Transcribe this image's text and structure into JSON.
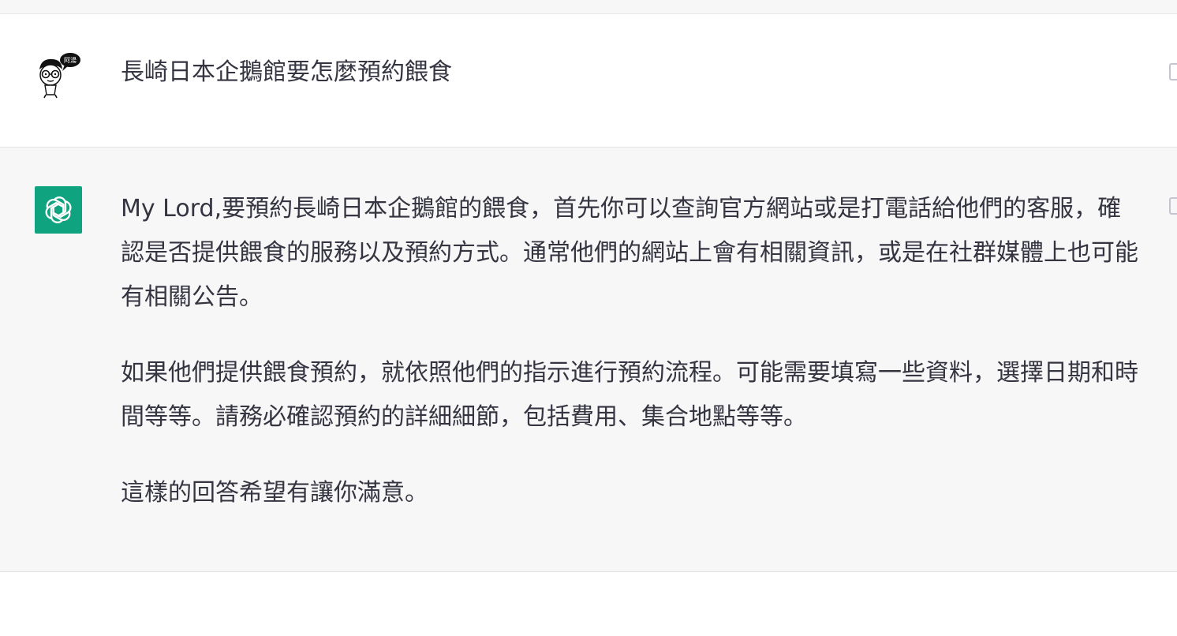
{
  "conversation": {
    "user_message": {
      "avatar_text": "阿湯",
      "text": "長崎日本企鵝館要怎麼預約餵食"
    },
    "assistant_message": {
      "paragraphs": [
        "My Lord,要預約長崎日本企鵝館的餵食，首先你可以查詢官方網站或是打電話給他們的客服，確認是否提供餵食的服務以及預約方式。通常他們的網站上會有相關資訊，或是在社群媒體上也可能有相關公告。",
        "如果他們提供餵食預約，就依照他們的指示進行預約流程。可能需要填寫一些資料，選擇日期和時間等等。請務必確認預約的詳細細節，包括費用、集合地點等等。",
        "這樣的回答希望有讓你滿意。"
      ]
    }
  },
  "icons": {
    "user_avatar": "cartoon-avatar-icon",
    "assistant_avatar": "openai-logo-icon",
    "edit": "edit-icon",
    "copy": "copy-icon"
  },
  "colors": {
    "assistant_avatar_bg": "#10a37f",
    "assistant_row_bg": "#f7f7f8",
    "text": "#343541"
  }
}
